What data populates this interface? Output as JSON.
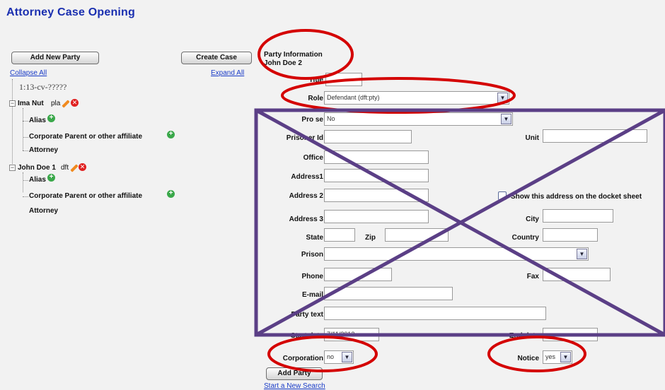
{
  "app": {
    "title": "Attorney Case Opening"
  },
  "left": {
    "add_party_label": "Add New Party",
    "create_case_label": "Create Case",
    "collapse_all": "Collapse All",
    "expand_all": "Expand All",
    "case_number": "1:13-cv-?????",
    "parties": [
      {
        "name": "Ima Nut",
        "role": "pla",
        "children": [
          "Alias",
          "Corporate Parent or other affiliate",
          "Attorney"
        ]
      },
      {
        "name": "John Doe 1",
        "role": "dft",
        "children": [
          "Alias",
          "Corporate Parent or other affiliate",
          "Attorney"
        ]
      }
    ]
  },
  "form": {
    "heading": "Party Information",
    "party_name": "John Doe 2",
    "fields": {
      "title": {
        "label": "Title",
        "value": ""
      },
      "role": {
        "label": "Role",
        "value": "Defendant (dft:pty)"
      },
      "prose": {
        "label": "Pro se",
        "value": "No"
      },
      "prisoner_id": {
        "label": "Prisoner Id",
        "value": ""
      },
      "unit": {
        "label": "Unit",
        "value": ""
      },
      "office": {
        "label": "Office",
        "value": ""
      },
      "address1": {
        "label": "Address1",
        "value": ""
      },
      "address2": {
        "label": "Address 2",
        "value": ""
      },
      "show_address": {
        "label": "Show this address on the docket sheet",
        "checked": false
      },
      "address3": {
        "label": "Address 3",
        "value": ""
      },
      "city": {
        "label": "City",
        "value": ""
      },
      "state": {
        "label": "State",
        "value": ""
      },
      "zip": {
        "label": "Zip",
        "value": ""
      },
      "country": {
        "label": "Country",
        "value": ""
      },
      "prison": {
        "label": "Prison",
        "value": ""
      },
      "phone": {
        "label": "Phone",
        "value": ""
      },
      "fax": {
        "label": "Fax",
        "value": ""
      },
      "email": {
        "label": "E-mail",
        "value": ""
      },
      "party_text": {
        "label": "Party text",
        "value": ""
      },
      "start_date": {
        "label": "Start date",
        "value": "7/11/2013"
      },
      "end_date": {
        "label": "End date",
        "value": ""
      },
      "corporation": {
        "label": "Corporation",
        "value": "no"
      },
      "notice": {
        "label": "Notice",
        "value": "yes"
      }
    },
    "add_party_button": "Add Party",
    "new_search_link": "Start a New Search"
  },
  "colors": {
    "annotation_red": "#d40000",
    "annotation_purple": "#5b3f86",
    "title_blue": "#1a2fb0",
    "link_blue": "#1a3cc7"
  }
}
